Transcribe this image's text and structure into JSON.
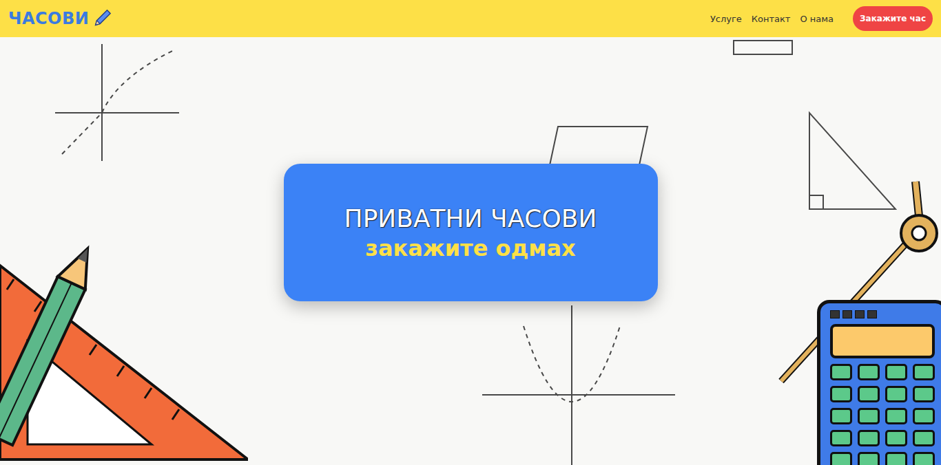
{
  "header": {
    "logo": "ЧАСОВИ",
    "nav": [
      {
        "label": "Услуге"
      },
      {
        "label": "Контакт"
      },
      {
        "label": "О нама"
      }
    ],
    "cta": "Закажите час"
  },
  "hero": {
    "title": "ПРИВАТНИ ЧАСОВИ",
    "subtitle": "закажите одмах"
  }
}
